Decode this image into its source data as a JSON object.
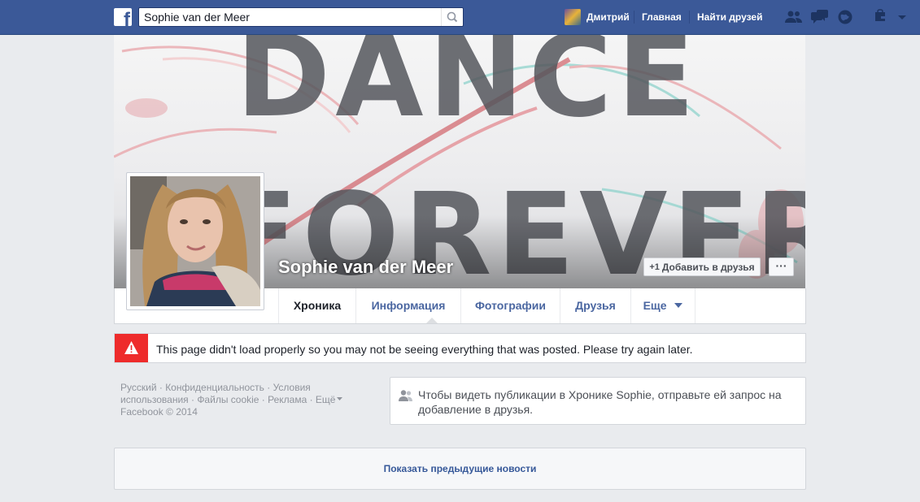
{
  "topbar": {
    "search_value": "Sophie van der Meer",
    "user_name": "Дмитрий",
    "home_label": "Главная",
    "find_friends_label": "Найти друзей"
  },
  "cover": {
    "word_top": "DANCE",
    "word_bottom": "FOREVER"
  },
  "profile": {
    "name": "Sophie van der Meer",
    "add_friend_label": "Добавить в друзья",
    "add_friend_glyph": "+1",
    "more_label": "···"
  },
  "tabs": [
    {
      "label": "Хроника"
    },
    {
      "label": "Информация"
    },
    {
      "label": "Фотографии"
    },
    {
      "label": "Друзья"
    },
    {
      "label": "Еще"
    }
  ],
  "error": {
    "text": "This page didn't load properly so you may not be seeing everything that was posted. Please try again later."
  },
  "footer": {
    "line1": "Русский · Конфиденциальность · Условия",
    "line2": "использования · Файлы cookie · Реклама · Ещё",
    "line3": "Facebook © 2014"
  },
  "friend_request": {
    "message": "Чтобы видеть публикации в Хронике Sophie, отправьте ей запрос на добавление в друзья."
  },
  "show_previous": {
    "label": "Показать предыдущие новости"
  },
  "colors": {
    "brand": "#3b5998",
    "link": "#4b67a1",
    "error": "#ee2b2b"
  }
}
